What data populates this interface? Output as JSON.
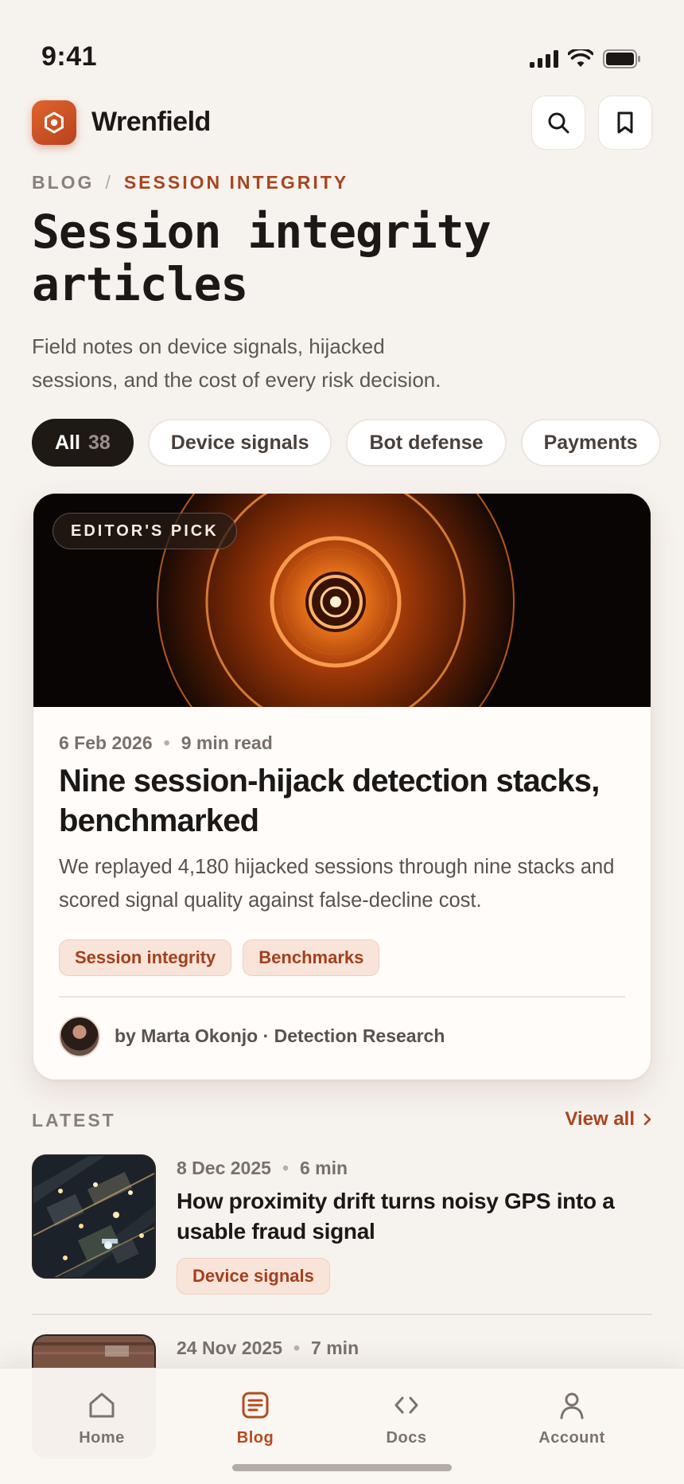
{
  "status_bar": {
    "time": "9:41"
  },
  "header": {
    "brand": "Wrenfield",
    "icons": [
      "search-icon",
      "bookmark-icon"
    ]
  },
  "breadcrumb": {
    "root": "BLOG",
    "separator": "/",
    "current": "SESSION INTEGRITY"
  },
  "page": {
    "title_line1": "Session integrity",
    "title_line2": "articles",
    "subtitle_line1": "Field notes on device signals, hijacked",
    "subtitle_line2": "sessions, and the cost of every risk decision."
  },
  "filters": [
    {
      "label": "All",
      "count": "38",
      "active": true
    },
    {
      "label": "Device signals"
    },
    {
      "label": "Bot defense"
    },
    {
      "label": "Payments"
    }
  ],
  "featured": {
    "badge": "EDITOR'S PICK",
    "date": "6 Feb 2026",
    "read_time": "9 min read",
    "title": "Nine session-hijack detection stacks, benchmarked",
    "excerpt": "We replayed 4,180 hijacked sessions through nine stacks and scored signal quality against false-decline cost.",
    "tags": [
      "Session integrity",
      "Benchmarks"
    ],
    "author": "by Marta Okonjo · Detection Research"
  },
  "latest": {
    "label": "LATEST",
    "view_all": "View all",
    "articles": [
      {
        "date": "8 Dec 2025",
        "read_time": "6 min",
        "title": "How proximity drift turns noisy GPS into a usable fraud signal",
        "tag": "Device signals"
      },
      {
        "date": "24 Nov 2025",
        "read_time": "7 min"
      }
    ]
  },
  "tabs": [
    {
      "label": "Home",
      "icon": "home-icon"
    },
    {
      "label": "Blog",
      "icon": "blog-icon",
      "active": true
    },
    {
      "label": "Docs",
      "icon": "code-icon"
    },
    {
      "label": "Account",
      "icon": "user-icon"
    }
  ],
  "colors": {
    "accent": "#a8451f",
    "ink": "#1c1816",
    "background": "#f6f2ee",
    "tag_bg": "#f9e4da"
  }
}
